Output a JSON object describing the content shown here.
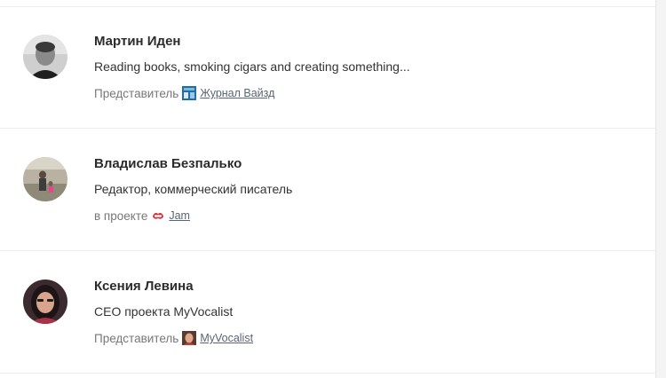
{
  "people": [
    {
      "name": "Мартин Иден",
      "bio": "Reading books, smoking cigars and creating something...",
      "role_prefix": "Представитель",
      "org_name": "Журнал Вайзд",
      "org_icon": "wired-magazine-icon",
      "org_color": "#1e6fa8"
    },
    {
      "name": "Владислав Безпалько",
      "bio": "Редактор, коммерческий писатель",
      "role_prefix": "в проекте",
      "org_name": "Jam",
      "org_icon": "jam-logo-icon",
      "org_color": "#d9232d"
    },
    {
      "name": "Ксения Левина",
      "bio": "CEO проекта MyVocalist",
      "role_prefix": "Представитель",
      "org_name": "MyVocalist",
      "org_icon": "myvocalist-logo-icon",
      "org_color": "#b5453a"
    }
  ]
}
